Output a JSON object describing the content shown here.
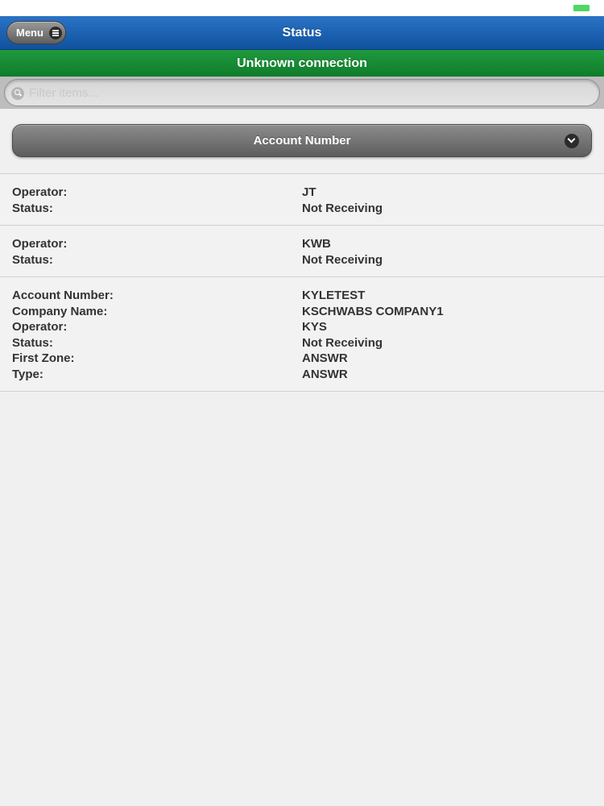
{
  "header": {
    "title": "Status",
    "menu_label": "Menu"
  },
  "connection": {
    "text": "Unknown connection",
    "color": "#138a33"
  },
  "filter": {
    "placeholder": "Filter items..."
  },
  "sort_select": {
    "selected": "Account Number"
  },
  "items": [
    {
      "rows": [
        {
          "label": "Operator:",
          "value": "JT"
        },
        {
          "label": "Status:",
          "value": "Not Receiving"
        }
      ]
    },
    {
      "rows": [
        {
          "label": "Operator:",
          "value": "KWB"
        },
        {
          "label": "Status:",
          "value": "Not Receiving"
        }
      ]
    },
    {
      "rows": [
        {
          "label": "Account Number:",
          "value": "KYLETEST"
        },
        {
          "label": "Company Name:",
          "value": "KSCHWABS COMPANY1"
        },
        {
          "label": "Operator:",
          "value": "KYS"
        },
        {
          "label": "Status:",
          "value": "Not Receiving"
        },
        {
          "label": "First Zone:",
          "value": "ANSWR"
        },
        {
          "label": "Type:",
          "value": "ANSWR"
        }
      ]
    }
  ],
  "icons": {
    "menu": "hamburger-icon",
    "search": "search-icon",
    "dropdown": "chevron-down-icon"
  }
}
